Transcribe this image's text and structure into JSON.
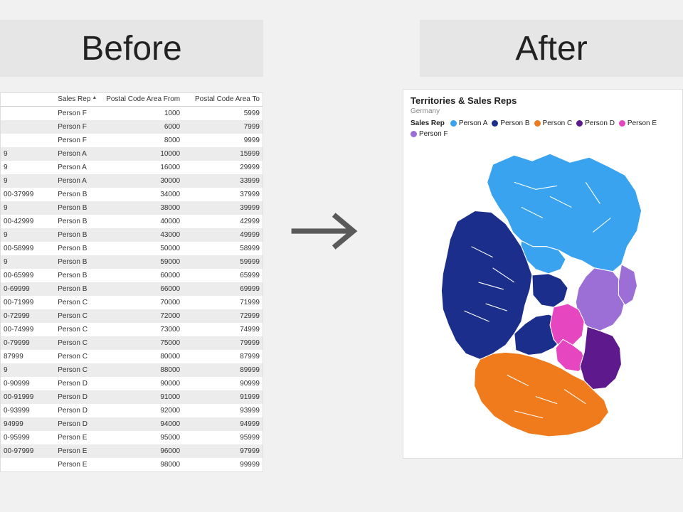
{
  "headers": {
    "before": "Before",
    "after": "After"
  },
  "table": {
    "columns": {
      "id": "",
      "rep": "Sales Rep",
      "from": "Postal Code Area From",
      "to": "Postal Code Area To"
    },
    "rows": [
      {
        "id": "",
        "rep": "Person F",
        "from": 1000,
        "to": 5999
      },
      {
        "id": "",
        "rep": "Person F",
        "from": 6000,
        "to": 7999
      },
      {
        "id": "",
        "rep": "Person F",
        "from": 8000,
        "to": 9999
      },
      {
        "id": "9",
        "rep": "Person A",
        "from": 10000,
        "to": 15999
      },
      {
        "id": "9",
        "rep": "Person A",
        "from": 16000,
        "to": 29999
      },
      {
        "id": "9",
        "rep": "Person A",
        "from": 30000,
        "to": 33999
      },
      {
        "id": "00-37999",
        "rep": "Person B",
        "from": 34000,
        "to": 37999
      },
      {
        "id": "9",
        "rep": "Person B",
        "from": 38000,
        "to": 39999
      },
      {
        "id": "00-42999",
        "rep": "Person B",
        "from": 40000,
        "to": 42999
      },
      {
        "id": "9",
        "rep": "Person B",
        "from": 43000,
        "to": 49999
      },
      {
        "id": "00-58999",
        "rep": "Person B",
        "from": 50000,
        "to": 58999
      },
      {
        "id": "9",
        "rep": "Person B",
        "from": 59000,
        "to": 59999
      },
      {
        "id": "00-65999",
        "rep": "Person B",
        "from": 60000,
        "to": 65999
      },
      {
        "id": "0-69999",
        "rep": "Person B",
        "from": 66000,
        "to": 69999
      },
      {
        "id": "00-71999",
        "rep": "Person C",
        "from": 70000,
        "to": 71999
      },
      {
        "id": "0-72999",
        "rep": "Person C",
        "from": 72000,
        "to": 72999
      },
      {
        "id": "00-74999",
        "rep": "Person C",
        "from": 73000,
        "to": 74999
      },
      {
        "id": "0-79999",
        "rep": "Person C",
        "from": 75000,
        "to": 79999
      },
      {
        "id": "87999",
        "rep": "Person C",
        "from": 80000,
        "to": 87999
      },
      {
        "id": "9",
        "rep": "Person C",
        "from": 88000,
        "to": 89999
      },
      {
        "id": "0-90999",
        "rep": "Person D",
        "from": 90000,
        "to": 90999
      },
      {
        "id": "00-91999",
        "rep": "Person D",
        "from": 91000,
        "to": 91999
      },
      {
        "id": "0-93999",
        "rep": "Person D",
        "from": 92000,
        "to": 93999
      },
      {
        "id": "94999",
        "rep": "Person D",
        "from": 94000,
        "to": 94999
      },
      {
        "id": "0-95999",
        "rep": "Person E",
        "from": 95000,
        "to": 95999
      },
      {
        "id": "00-97999",
        "rep": "Person E",
        "from": 96000,
        "to": 97999
      },
      {
        "id": "",
        "rep": "Person E",
        "from": 98000,
        "to": 99999
      }
    ]
  },
  "report": {
    "title": "Territories & Sales Reps",
    "subtitle": "Germany",
    "legend_label": "Sales Rep",
    "legend": [
      {
        "name": "Person A",
        "color": "#39a3f0"
      },
      {
        "name": "Person B",
        "color": "#1b2e8b"
      },
      {
        "name": "Person C",
        "color": "#ef7b1d"
      },
      {
        "name": "Person D",
        "color": "#5e1a8c"
      },
      {
        "name": "Person E",
        "color": "#e646bf"
      },
      {
        "name": "Person F",
        "color": "#9b6fd6"
      }
    ]
  },
  "chart_data": {
    "type": "table",
    "title": "Territories & Sales Reps",
    "country": "Germany",
    "description": "Choropleth of German postal-code areas colored by assigned sales representative.",
    "color_field": "Sales Rep",
    "categories": [
      "Person A",
      "Person B",
      "Person C",
      "Person D",
      "Person E",
      "Person F"
    ],
    "colors": [
      "#39a3f0",
      "#1b2e8b",
      "#ef7b1d",
      "#5e1a8c",
      "#e646bf",
      "#9b6fd6"
    ],
    "postal_ranges": [
      {
        "from": 1000,
        "to": 5999,
        "sales_rep": "Person F"
      },
      {
        "from": 6000,
        "to": 7999,
        "sales_rep": "Person F"
      },
      {
        "from": 8000,
        "to": 9999,
        "sales_rep": "Person F"
      },
      {
        "from": 10000,
        "to": 15999,
        "sales_rep": "Person A"
      },
      {
        "from": 16000,
        "to": 29999,
        "sales_rep": "Person A"
      },
      {
        "from": 30000,
        "to": 33999,
        "sales_rep": "Person A"
      },
      {
        "from": 34000,
        "to": 37999,
        "sales_rep": "Person B"
      },
      {
        "from": 38000,
        "to": 39999,
        "sales_rep": "Person B"
      },
      {
        "from": 40000,
        "to": 42999,
        "sales_rep": "Person B"
      },
      {
        "from": 43000,
        "to": 49999,
        "sales_rep": "Person B"
      },
      {
        "from": 50000,
        "to": 58999,
        "sales_rep": "Person B"
      },
      {
        "from": 59000,
        "to": 59999,
        "sales_rep": "Person B"
      },
      {
        "from": 60000,
        "to": 65999,
        "sales_rep": "Person B"
      },
      {
        "from": 66000,
        "to": 69999,
        "sales_rep": "Person B"
      },
      {
        "from": 70000,
        "to": 71999,
        "sales_rep": "Person C"
      },
      {
        "from": 72000,
        "to": 72999,
        "sales_rep": "Person C"
      },
      {
        "from": 73000,
        "to": 74999,
        "sales_rep": "Person C"
      },
      {
        "from": 75000,
        "to": 79999,
        "sales_rep": "Person C"
      },
      {
        "from": 80000,
        "to": 87999,
        "sales_rep": "Person C"
      },
      {
        "from": 88000,
        "to": 89999,
        "sales_rep": "Person C"
      },
      {
        "from": 90000,
        "to": 90999,
        "sales_rep": "Person D"
      },
      {
        "from": 91000,
        "to": 91999,
        "sales_rep": "Person D"
      },
      {
        "from": 92000,
        "to": 93999,
        "sales_rep": "Person D"
      },
      {
        "from": 94000,
        "to": 94999,
        "sales_rep": "Person D"
      },
      {
        "from": 95000,
        "to": 95999,
        "sales_rep": "Person E"
      },
      {
        "from": 96000,
        "to": 97999,
        "sales_rep": "Person E"
      },
      {
        "from": 98000,
        "to": 99999,
        "sales_rep": "Person E"
      }
    ]
  }
}
